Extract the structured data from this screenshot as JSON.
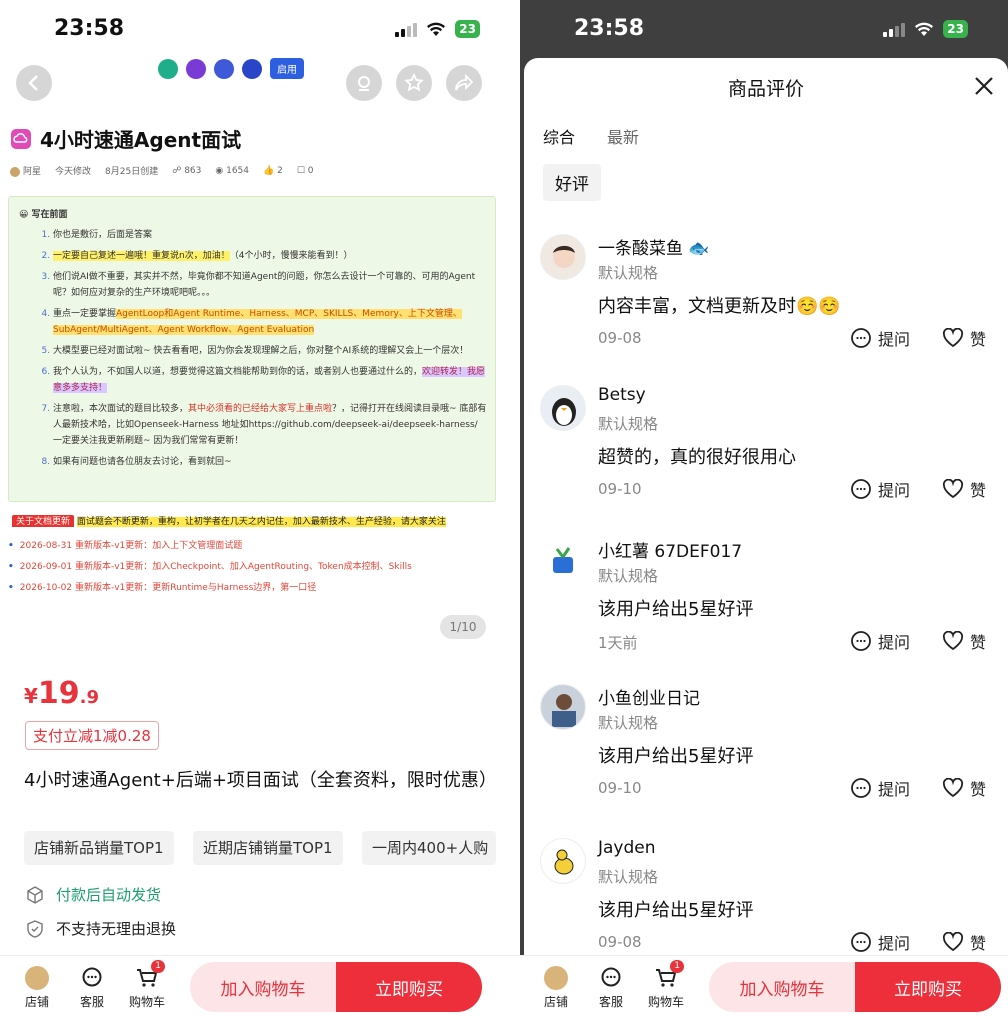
{
  "status": {
    "time": "23:58",
    "battery": "23"
  },
  "left": {
    "doc_title": "4小时速通Agent面试",
    "meta": {
      "author": "阿星",
      "modified": "今天修改",
      "created": "8月25日创建",
      "views": "863",
      "reads": "1654",
      "likes": "2",
      "comments": "0"
    },
    "trial_label": "启用",
    "intro": {
      "heading": "写在前面",
      "items": [
        {
          "text": "你也是敷衍，后面是答案"
        },
        {
          "hl": "一定要自己复述一遍哦！重复说n次，加油！",
          "text": "（4个小时，慢慢来能看到！）"
        },
        {
          "text": "他们说AI做不重要，其实并不然，毕竟你都不知道Agent的问题，你怎么去设计一个可靠的、可用的Agent呢？如何应对复杂的生产环境呢吧呢。。。"
        },
        {
          "pre": "重点一定要掌握",
          "hl": "AgentLoop和Agent Runtime、Harness、MCP、SKILLS、Memory、上下文管理、SubAgent/MultiAgent、Agent Workflow、Agent Evaluation"
        },
        {
          "text": "大模型要已经对面试啦~ 快去看看吧，因为你会发现理解之后，你对整个AI系统的理解又会上一个层次！"
        },
        {
          "pre": "我个人认为，不如国人以道，想要觉得这篇文档能帮助到你的话，或者别人也要通过什么的，",
          "hl": "欢迎转发！我愿意多多支持！"
        },
        {
          "pre": "注意啦，本次面试的题目比较多，",
          "red": "其中必须看的已经给大家写上重点啦",
          "post": "？，记得打开在线阅读目录哦~ 底部有人最新技术哈，比如Openseek-Harness 地址如https://github.com/deepseek-ai/deepseek-harness/ 一定要关注我更新刷题~ 因为我们常常有更新！"
        },
        {
          "text": "如果有问题也请各位朋友去讨论，看到就回~"
        }
      ]
    },
    "notice": {
      "badge": "关于文档更新",
      "bar": "面试题会不断更新，重构，让初学者在几天之内记住，加入最新技术、生产经验，请大家关注"
    },
    "changes": [
      {
        "date": "2026-08-31",
        "text": "重新版本-v1更新：加入上下文管理面试题"
      },
      {
        "date": "2026-09-01",
        "text": "重新版本-v1更新：加入Checkpoint、加入AgentRouting、Token成本控制、Skills"
      },
      {
        "date": "2026-10-02",
        "text": "重新版本-v1更新：更新Runtime与Harness边界，第一口径"
      }
    ],
    "pager": "1/10",
    "price": {
      "symbol": "¥",
      "int": "19",
      "dec": ".9"
    },
    "coupon": "支付立减1减0.28",
    "product_title": "4小时速通Agent+后端+项目面试（全套资料，限时优惠）",
    "ranks": [
      "店铺新品销量TOP1",
      "近期店铺销量TOP1",
      "一周内400+人购"
    ],
    "ship1": "付款后自动发货",
    "ship2": "不支持无理由退换"
  },
  "bottom": {
    "store": "店铺",
    "service": "客服",
    "cart": "购物车",
    "cart_count": "1",
    "add_cart": "加入购物车",
    "buy_now": "立即购买"
  },
  "right": {
    "title": "商品评价",
    "tabs": [
      "综合",
      "最新"
    ],
    "filter": "好评",
    "ask": "提问",
    "like": "赞",
    "reviews": [
      {
        "name": "一条酸菜鱼 🐟",
        "spec": "默认规格",
        "text": "内容丰富，文档更新及时☺️☺️",
        "date": "09-08"
      },
      {
        "name": "Betsy",
        "spec": "默认规格",
        "text": "超赞的，真的很好很用心",
        "date": "09-10"
      },
      {
        "name": "小红薯 67DEF017",
        "spec": "默认规格",
        "text": "该用户给出5星好评",
        "date": "1天前"
      },
      {
        "name": "小鱼创业日记",
        "spec": "默认规格",
        "text": "该用户给出5星好评",
        "date": "09-10"
      },
      {
        "name": "Jayden",
        "spec": "默认规格",
        "text": "该用户给出5星好评",
        "date": "09-08"
      }
    ]
  }
}
